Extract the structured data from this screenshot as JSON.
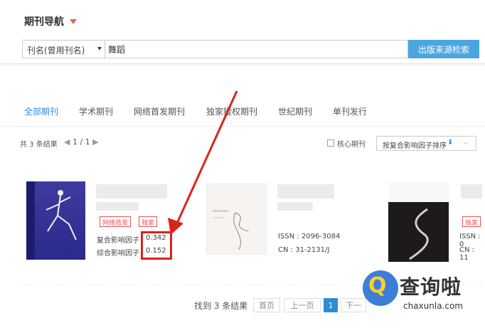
{
  "nav": {
    "title": "期刊导航"
  },
  "search": {
    "field_label": "刊名(曾用刊名)",
    "query": "舞蹈",
    "button_label": "出版来源检索"
  },
  "tabs": [
    {
      "label": "全部期刊",
      "active": true
    },
    {
      "label": "学术期刊",
      "active": false
    },
    {
      "label": "网络首发期刊",
      "active": false
    },
    {
      "label": "独家授权期刊",
      "active": false
    },
    {
      "label": "世纪期刊",
      "active": false
    },
    {
      "label": "单刊发行",
      "active": false
    }
  ],
  "results": {
    "summary": "共 3 条结果",
    "page_indicator": "1 / 1",
    "core_journal_label": "核心期刊",
    "sort_label": "按复合影响因子排序"
  },
  "journals": [
    {
      "badges": [
        "网络首发",
        "独家"
      ],
      "fields": [
        {
          "label": "复合影响因子",
          "value": "0.342"
        },
        {
          "label": "综合影响因子",
          "value": "0.152"
        }
      ]
    },
    {
      "fields": [
        {
          "label": "ISSN",
          "value": "2096-3084"
        },
        {
          "label": "CN",
          "value": "31-2131/J"
        }
      ]
    },
    {
      "badges": [
        "独家"
      ],
      "fields": [
        {
          "label": "ISSN",
          "value": "0"
        },
        {
          "label": "CN",
          "value": "11"
        }
      ]
    }
  ],
  "pagination": {
    "found": "找到 3 条结果",
    "first": "首页",
    "prev": "上一页",
    "current": "1",
    "next": "下一"
  },
  "watermark": {
    "text": "查询啦",
    "url": "chaxunla.com",
    "icon_glyph": "Q"
  },
  "colors": {
    "accent": "#2e8bd7",
    "search_button": "#4aa6e0",
    "badge": "#ee5555",
    "highlight": "#d9241b"
  }
}
